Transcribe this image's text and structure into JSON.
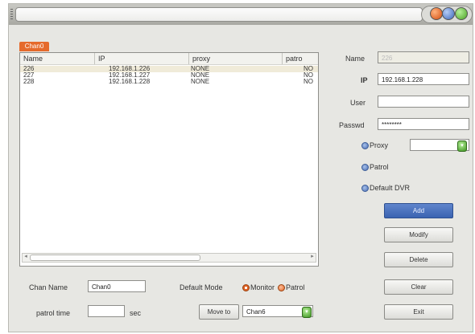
{
  "group_tab": "Chan0",
  "columns": [
    "Name",
    "IP",
    "proxy",
    "patro"
  ],
  "rows": [
    {
      "name": "226",
      "ip": "192.168.1.226",
      "proxy": "NONE",
      "patrol": "NO"
    },
    {
      "name": "227",
      "ip": "192.168.1.227",
      "proxy": "NONE",
      "patrol": "NO"
    },
    {
      "name": "228",
      "ip": "192.168.1.228",
      "proxy": "NONE",
      "patrol": "NO"
    }
  ],
  "form": {
    "name_label": "Name",
    "name_value": "226",
    "ip_label": "IP",
    "ip_value": "192.168.1.228",
    "user_label": "User",
    "user_value": "",
    "password_label": "Passwd",
    "password_value": "********",
    "proxy_label": "Proxy",
    "proxy_value": "",
    "patrol_label": "Patrol",
    "default_dvr_label": "Default DVR"
  },
  "buttons": {
    "add": "Add",
    "modify": "Modify",
    "delete": "Delete",
    "clear": "Clear",
    "exit": "Exit",
    "move_to": "Move to"
  },
  "bottom": {
    "chan_name_label": "Chan Name",
    "chan_name_value": "Chan0",
    "default_mode_label": "Default Mode",
    "monitor_label": "Monitor",
    "patrol_label": "Patrol",
    "patrol_time_label": "patrol time",
    "patrol_time_value": "",
    "sec_label": "sec",
    "move_to_value": "Chan6"
  },
  "icons": {
    "title_buttons": [
      "minimize-icon",
      "maximize-icon",
      "close-icon"
    ],
    "combo": "chevron-down-icon"
  },
  "colors": {
    "accent_orange": "#e56a2c",
    "primary_button": "#4a70bd",
    "window_bg": "#e7e7e3"
  }
}
